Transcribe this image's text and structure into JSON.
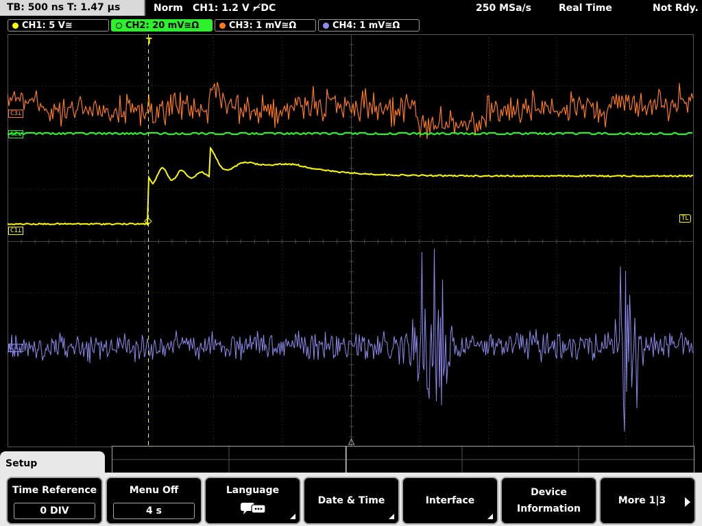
{
  "topbar": {
    "timebase": "TB: 500 ns   T: 1.47 µs",
    "mode": "Norm",
    "trigger": "CH1: 1.2 V ⌐̸DC",
    "sample_rate": "250 MSa/s",
    "acq_mode": "Real Time",
    "status": "Not Rdy."
  },
  "channels": [
    {
      "label": "CH1: 5 V≅",
      "color": "#ffff00"
    },
    {
      "label": "CH2: 20 mV≅Ω",
      "color": "#2eef2e"
    },
    {
      "label": "CH3: 1 mV≅Ω",
      "color": "#ff7a1a"
    },
    {
      "label": "CH4: 1 mV≅Ω",
      "color": "#8e8cf0"
    }
  ],
  "markers": {
    "c3": "C3⊥",
    "c2": "C2⊥",
    "c1": "C1⊥",
    "c4": "C4⊥",
    "tl": "TL",
    "trig": "T"
  },
  "menu": {
    "title": "Setup",
    "time_reference": {
      "label": "Time Reference",
      "value": "0 DIV"
    },
    "menu_off": {
      "label": "Menu Off",
      "value": "4 s"
    },
    "language": {
      "label": "Language",
      "icon": "speech-bubbles-icon"
    },
    "date_time": "Date & Time",
    "interface": "Interface",
    "device_info": {
      "line1": "Device",
      "line2": "Information"
    },
    "more": "More 1|3"
  }
}
